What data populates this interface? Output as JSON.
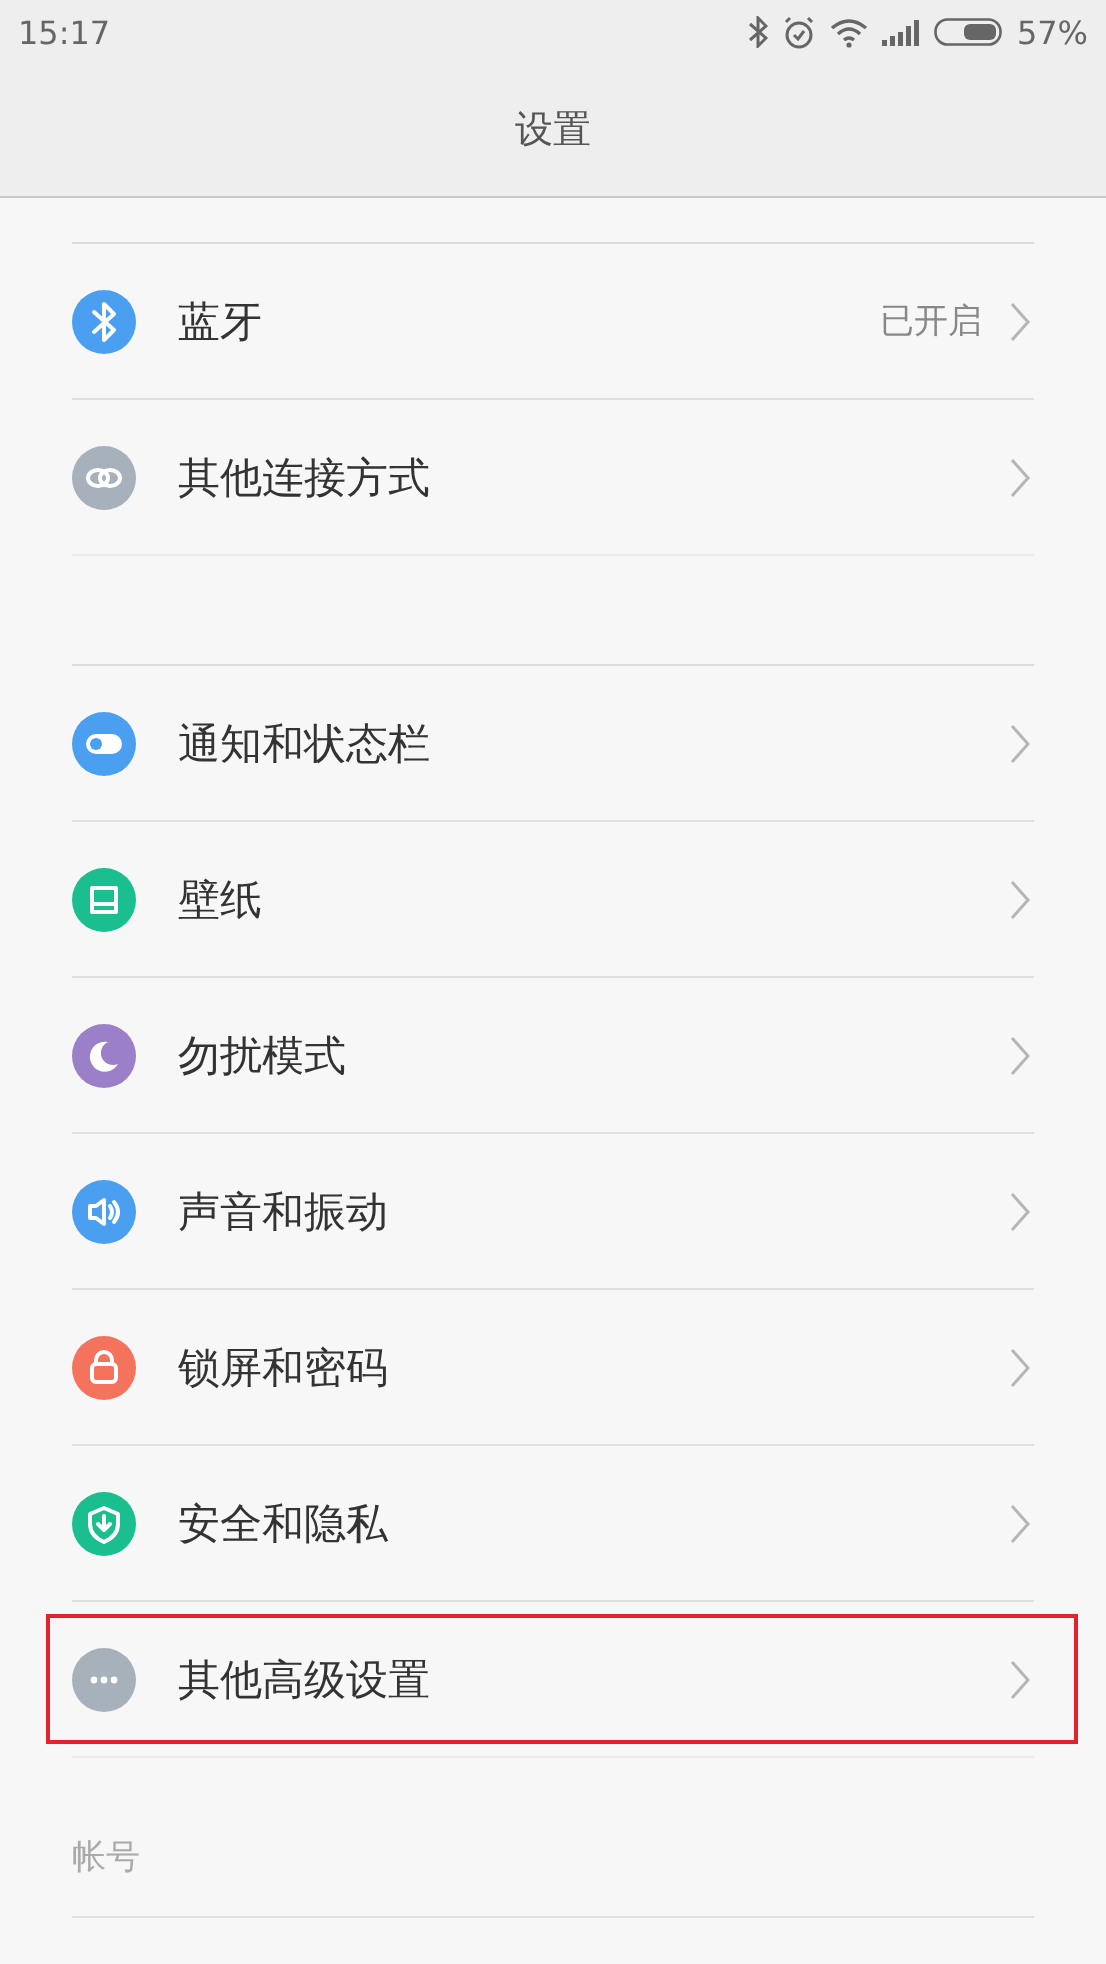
{
  "status_bar": {
    "time": "15:17",
    "battery": "57%"
  },
  "header": {
    "title": "设置"
  },
  "groups": [
    {
      "items": [
        {
          "label": "蓝牙",
          "kind": "bluetooth",
          "color": "#4a9ff0",
          "value": "已开启",
          "highlighted": false
        },
        {
          "label": "其他连接方式",
          "kind": "link",
          "color": "#a6b1bc",
          "highlighted": false
        }
      ]
    },
    {
      "items": [
        {
          "label": "通知和状态栏",
          "kind": "toggle",
          "color": "#4a9ff0",
          "highlighted": false
        },
        {
          "label": "壁纸",
          "kind": "wallpaper",
          "color": "#1bbf8f",
          "highlighted": false
        },
        {
          "label": "勿扰模式",
          "kind": "moon",
          "color": "#9b7fc8",
          "highlighted": false
        },
        {
          "label": "声音和振动",
          "kind": "speaker",
          "color": "#4a9ff0",
          "highlighted": false
        },
        {
          "label": "锁屏和密码",
          "kind": "lock",
          "color": "#f4735c",
          "highlighted": false
        },
        {
          "label": "安全和隐私",
          "kind": "shield",
          "color": "#1bbf8f",
          "highlighted": false
        },
        {
          "label": "其他高级设置",
          "kind": "more",
          "color": "#a6b1bc",
          "highlighted": true
        }
      ]
    }
  ],
  "section": {
    "title": "帐号"
  }
}
